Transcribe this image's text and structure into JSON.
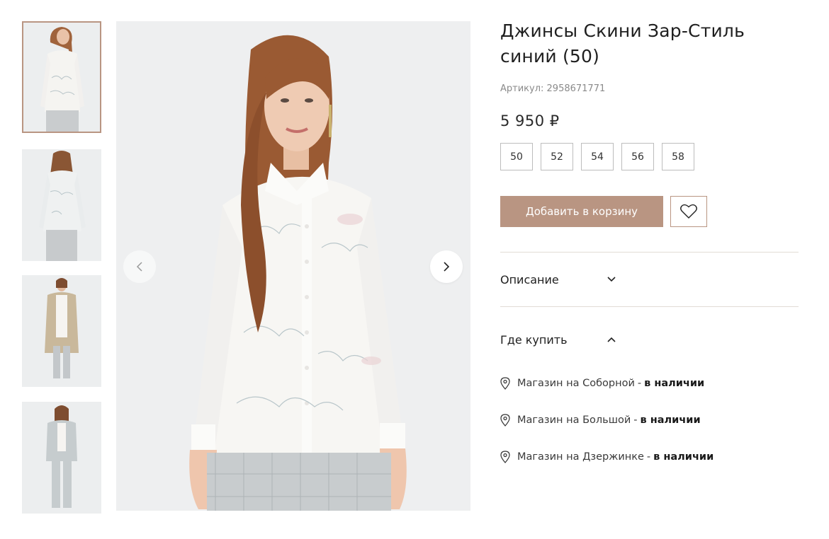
{
  "product": {
    "title": "Джинсы Скини Зар-Стиль синий (50)",
    "sku_label": "Артикул: 2958671771",
    "price": "5 950 ₽",
    "sizes": [
      "50",
      "52",
      "54",
      "56",
      "58"
    ],
    "add_to_cart": "Добавить в корзину"
  },
  "sections": {
    "description": "Описание",
    "where_to_buy": "Где купить"
  },
  "stores": [
    {
      "name": "Магазин на Соборной",
      "dash": "-",
      "status": "в наличии"
    },
    {
      "name": "Магазин на Большой",
      "dash": "-",
      "status": "в наличии"
    },
    {
      "name": "Магазин на Дзержинке",
      "dash": "-",
      "status": "в наличии"
    }
  ],
  "gallery": {
    "thumbnail_count": 4,
    "active_thumbnail": 1
  },
  "colors": {
    "accent": "#b99582",
    "text": "#1f1f1f",
    "muted": "#8a8a8a",
    "divider": "#e2dcd6"
  },
  "icons": {
    "prev": "chevron-left-icon",
    "next": "chevron-right-icon",
    "favorite": "heart-icon",
    "expand": "chevron-down-icon",
    "collapse": "chevron-up-icon",
    "store": "location-pin-icon"
  }
}
